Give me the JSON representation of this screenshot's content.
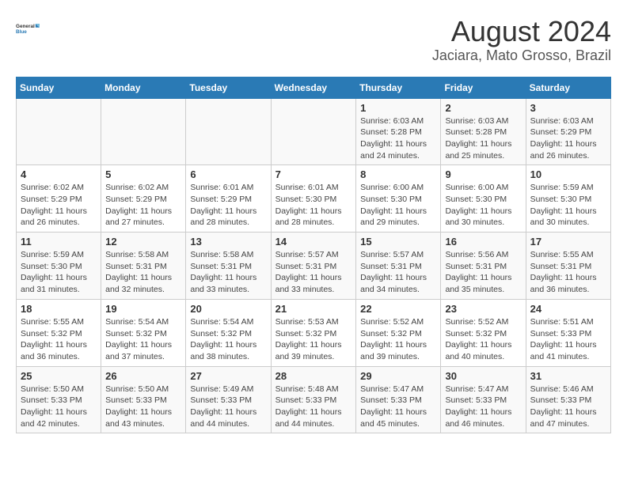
{
  "header": {
    "logo_line1": "General",
    "logo_line2": "Blue",
    "title": "August 2024",
    "subtitle": "Jaciara, Mato Grosso, Brazil"
  },
  "weekdays": [
    "Sunday",
    "Monday",
    "Tuesday",
    "Wednesday",
    "Thursday",
    "Friday",
    "Saturday"
  ],
  "weeks": [
    [
      {
        "day": "",
        "detail": ""
      },
      {
        "day": "",
        "detail": ""
      },
      {
        "day": "",
        "detail": ""
      },
      {
        "day": "",
        "detail": ""
      },
      {
        "day": "1",
        "detail": "Sunrise: 6:03 AM\nSunset: 5:28 PM\nDaylight: 11 hours and 24 minutes."
      },
      {
        "day": "2",
        "detail": "Sunrise: 6:03 AM\nSunset: 5:28 PM\nDaylight: 11 hours and 25 minutes."
      },
      {
        "day": "3",
        "detail": "Sunrise: 6:03 AM\nSunset: 5:29 PM\nDaylight: 11 hours and 26 minutes."
      }
    ],
    [
      {
        "day": "4",
        "detail": "Sunrise: 6:02 AM\nSunset: 5:29 PM\nDaylight: 11 hours and 26 minutes."
      },
      {
        "day": "5",
        "detail": "Sunrise: 6:02 AM\nSunset: 5:29 PM\nDaylight: 11 hours and 27 minutes."
      },
      {
        "day": "6",
        "detail": "Sunrise: 6:01 AM\nSunset: 5:29 PM\nDaylight: 11 hours and 28 minutes."
      },
      {
        "day": "7",
        "detail": "Sunrise: 6:01 AM\nSunset: 5:30 PM\nDaylight: 11 hours and 28 minutes."
      },
      {
        "day": "8",
        "detail": "Sunrise: 6:00 AM\nSunset: 5:30 PM\nDaylight: 11 hours and 29 minutes."
      },
      {
        "day": "9",
        "detail": "Sunrise: 6:00 AM\nSunset: 5:30 PM\nDaylight: 11 hours and 30 minutes."
      },
      {
        "day": "10",
        "detail": "Sunrise: 5:59 AM\nSunset: 5:30 PM\nDaylight: 11 hours and 30 minutes."
      }
    ],
    [
      {
        "day": "11",
        "detail": "Sunrise: 5:59 AM\nSunset: 5:30 PM\nDaylight: 11 hours and 31 minutes."
      },
      {
        "day": "12",
        "detail": "Sunrise: 5:58 AM\nSunset: 5:31 PM\nDaylight: 11 hours and 32 minutes."
      },
      {
        "day": "13",
        "detail": "Sunrise: 5:58 AM\nSunset: 5:31 PM\nDaylight: 11 hours and 33 minutes."
      },
      {
        "day": "14",
        "detail": "Sunrise: 5:57 AM\nSunset: 5:31 PM\nDaylight: 11 hours and 33 minutes."
      },
      {
        "day": "15",
        "detail": "Sunrise: 5:57 AM\nSunset: 5:31 PM\nDaylight: 11 hours and 34 minutes."
      },
      {
        "day": "16",
        "detail": "Sunrise: 5:56 AM\nSunset: 5:31 PM\nDaylight: 11 hours and 35 minutes."
      },
      {
        "day": "17",
        "detail": "Sunrise: 5:55 AM\nSunset: 5:31 PM\nDaylight: 11 hours and 36 minutes."
      }
    ],
    [
      {
        "day": "18",
        "detail": "Sunrise: 5:55 AM\nSunset: 5:32 PM\nDaylight: 11 hours and 36 minutes."
      },
      {
        "day": "19",
        "detail": "Sunrise: 5:54 AM\nSunset: 5:32 PM\nDaylight: 11 hours and 37 minutes."
      },
      {
        "day": "20",
        "detail": "Sunrise: 5:54 AM\nSunset: 5:32 PM\nDaylight: 11 hours and 38 minutes."
      },
      {
        "day": "21",
        "detail": "Sunrise: 5:53 AM\nSunset: 5:32 PM\nDaylight: 11 hours and 39 minutes."
      },
      {
        "day": "22",
        "detail": "Sunrise: 5:52 AM\nSunset: 5:32 PM\nDaylight: 11 hours and 39 minutes."
      },
      {
        "day": "23",
        "detail": "Sunrise: 5:52 AM\nSunset: 5:32 PM\nDaylight: 11 hours and 40 minutes."
      },
      {
        "day": "24",
        "detail": "Sunrise: 5:51 AM\nSunset: 5:33 PM\nDaylight: 11 hours and 41 minutes."
      }
    ],
    [
      {
        "day": "25",
        "detail": "Sunrise: 5:50 AM\nSunset: 5:33 PM\nDaylight: 11 hours and 42 minutes."
      },
      {
        "day": "26",
        "detail": "Sunrise: 5:50 AM\nSunset: 5:33 PM\nDaylight: 11 hours and 43 minutes."
      },
      {
        "day": "27",
        "detail": "Sunrise: 5:49 AM\nSunset: 5:33 PM\nDaylight: 11 hours and 44 minutes."
      },
      {
        "day": "28",
        "detail": "Sunrise: 5:48 AM\nSunset: 5:33 PM\nDaylight: 11 hours and 44 minutes."
      },
      {
        "day": "29",
        "detail": "Sunrise: 5:47 AM\nSunset: 5:33 PM\nDaylight: 11 hours and 45 minutes."
      },
      {
        "day": "30",
        "detail": "Sunrise: 5:47 AM\nSunset: 5:33 PM\nDaylight: 11 hours and 46 minutes."
      },
      {
        "day": "31",
        "detail": "Sunrise: 5:46 AM\nSunset: 5:33 PM\nDaylight: 11 hours and 47 minutes."
      }
    ]
  ]
}
